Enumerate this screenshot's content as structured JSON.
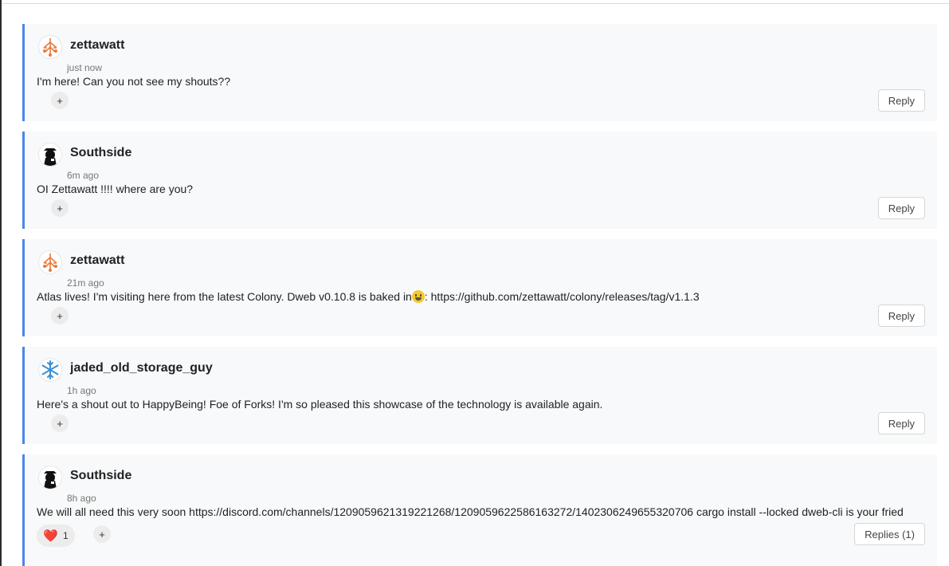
{
  "comments": [
    {
      "author": "zettawatt",
      "time": "just now",
      "text": "I'm here! Can you not see my shouts??",
      "action_label": "Reply",
      "plus_label": "+",
      "avatar_icon": "zettawatt-tree-icon"
    },
    {
      "author": "Southside",
      "time": "6m ago",
      "text": "OI Zettawatt !!!! where are you?",
      "action_label": "Reply",
      "plus_label": "+",
      "avatar_icon": "hat-figure-icon"
    },
    {
      "author": "zettawatt",
      "time": "21m ago",
      "text_before": "Atlas lives! I'm visiting here from the latest Colony. Dweb v0.10.8 is baked in",
      "text_after": ": https://github.com/zettawatt/colony/releases/tag/v1.1.3",
      "emoji": "grinning-face",
      "action_label": "Reply",
      "plus_label": "+",
      "avatar_icon": "zettawatt-tree-icon"
    },
    {
      "author": "jaded_old_storage_guy",
      "time": "1h ago",
      "text": "Here's a shout out to HappyBeing! Foe of Forks! I'm so pleased this showcase of the technology is available again.",
      "action_label": "Reply",
      "plus_label": "+",
      "avatar_icon": "snowflake-icon"
    },
    {
      "author": "Southside",
      "time": "8h ago",
      "text": "We will all need this very soon https://discord.com/channels/1209059621319221268/1209059622586163272/1402306249655320706 cargo install --locked dweb-cli is your fried",
      "action_label": "Replies (1)",
      "plus_label": "+",
      "reaction": {
        "emoji": "❤️",
        "count": "1"
      },
      "avatar_icon": "hat-figure-icon"
    }
  ],
  "colors": {
    "accent": "#4a86e8",
    "card_bg": "#f8f9fa",
    "heart": "#e0223a",
    "zettawatt_orange": "#e87a3c",
    "snowflake_blue": "#3a8fd6"
  }
}
